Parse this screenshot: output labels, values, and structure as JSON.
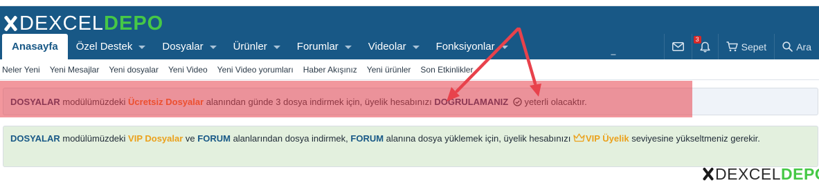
{
  "brand": {
    "logo_main": "DEXCEL",
    "logo_accent": "DEPO"
  },
  "nav": {
    "tabs": [
      {
        "label": "Anasayfa",
        "active": true,
        "caret": false
      },
      {
        "label": "Özel Destek",
        "active": false,
        "caret": true
      },
      {
        "label": "Dosyalar",
        "active": false,
        "caret": true
      },
      {
        "label": "Ürünler",
        "active": false,
        "caret": true
      },
      {
        "label": "Forumlar",
        "active": false,
        "caret": true
      },
      {
        "label": "Videolar",
        "active": false,
        "caret": true
      },
      {
        "label": "Fonksiyonlar",
        "active": false,
        "caret": true
      }
    ],
    "search_input_value": "_",
    "alerts_count": "3",
    "cart_label": "Sepet",
    "search_label": "Ara"
  },
  "subnav": {
    "items": [
      "Neler Yeni",
      "Yeni Mesajlar",
      "Yeni dosyalar",
      "Yeni Video",
      "Yeni Video yorumları",
      "Haber Akışınız",
      "Yeni ürünler",
      "Son Etkinlikler"
    ]
  },
  "notice_1": {
    "part1": "DOSYALAR",
    "part2": " modülümüzdeki ",
    "part3": "Ücretsiz Dosyalar",
    "part4": " alanından günde 3 dosya indirmek için, üyelik hesabınızı ",
    "part5": "DOĞRULAMANIZ",
    "part6": " yeterli olacaktır."
  },
  "notice_2": {
    "part1": "DOSYALAR",
    "part2": " modülümüzdeki ",
    "part3": "VIP Dosyalar",
    "part4": " ve ",
    "part5": "FORUM",
    "part6": " alanlarından dosya indirmek, ",
    "part7": "FORUM",
    "part8": " alanına dosya yüklemek için, üyelik hesabınızı ",
    "part9": "VIP Üyelik",
    "part10": " seviyesine yükseltmeniz gerekir."
  },
  "colors": {
    "header_bg": "#185886",
    "logo_accent": "#46c846",
    "highlight_red": "#e8424c",
    "notice_2_bg": "#e3f0de",
    "orange_text": "#f2600c",
    "gold_text": "#eba11c"
  },
  "watermark": {
    "main": "DEXCEL",
    "accent": "DEPO"
  }
}
